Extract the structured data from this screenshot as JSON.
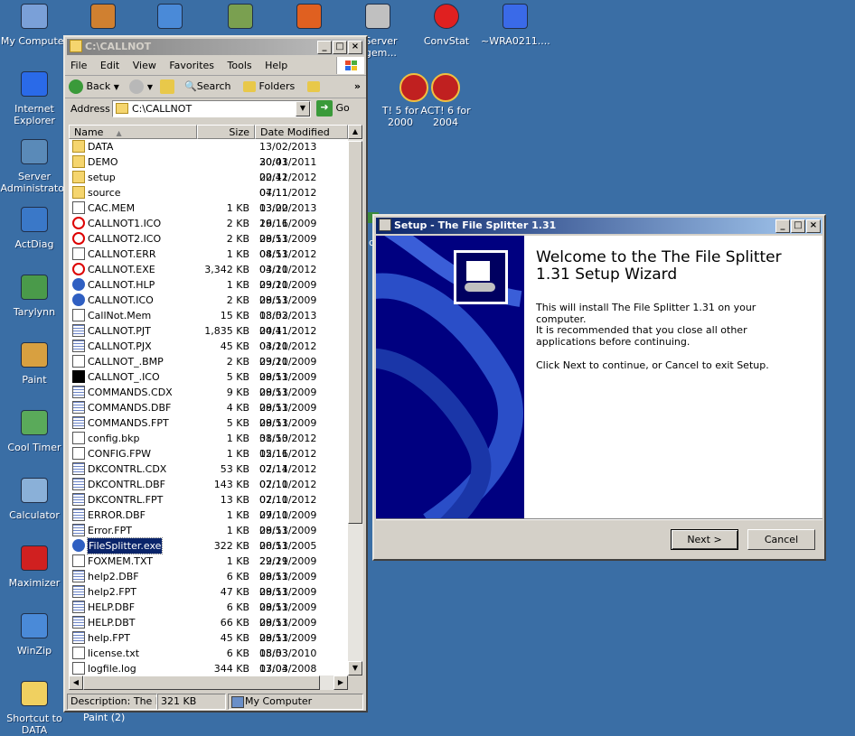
{
  "desktop": {
    "icons_left": [
      {
        "label": "My Computer",
        "icon": "computer-icon"
      },
      {
        "label": "Internet Explorer",
        "icon": "ie-icon"
      },
      {
        "label": "Server Administrator",
        "icon": "server-admin-icon"
      },
      {
        "label": "ActDiag",
        "icon": "toolbox-icon"
      },
      {
        "label": "Tarylynn",
        "icon": "network-icon"
      },
      {
        "label": "Paint",
        "icon": "paint-icon"
      },
      {
        "label": "Cool Timer",
        "icon": "timer-icon"
      },
      {
        "label": "Calculator",
        "icon": "calculator-icon"
      },
      {
        "label": "Maximizer",
        "icon": "maximizer-icon"
      },
      {
        "label": "WinZip",
        "icon": "winzip-icon"
      },
      {
        "label": "Shortcut to DATA",
        "icon": "folder-shortcut-icon"
      }
    ],
    "icons_top": [
      {
        "label": "",
        "icon": "handshake-icon"
      },
      {
        "label": "",
        "icon": "sync-icon"
      },
      {
        "label": "",
        "icon": "handshake-icon"
      },
      {
        "label": "",
        "icon": "fox-icon"
      },
      {
        "label": ". Server agem...",
        "icon": "server-manager-icon"
      },
      {
        "label": "ConvStat",
        "icon": "target-icon"
      },
      {
        "label": "~WRA0211....",
        "icon": "word-doc-icon"
      }
    ],
    "icons_mid": [
      {
        "label": "T! 5 for 2000",
        "icon": "act-icon"
      },
      {
        "label": "ACT! 6 for 2004",
        "icon": "act-icon"
      }
    ],
    "paint2_label": "Paint (2)",
    "stray_label": "d"
  },
  "explorer": {
    "title": "C:\\CALLNOT",
    "menu": [
      "File",
      "Edit",
      "View",
      "Favorites",
      "Tools",
      "Help"
    ],
    "toolbar": {
      "back": "Back",
      "search": "Search",
      "folders": "Folders"
    },
    "address_label": "Address",
    "address_value": "C:\\CALLNOT",
    "go_label": "Go",
    "columns": {
      "name": "Name",
      "size": "Size",
      "date": "Date Modified"
    },
    "files": [
      {
        "name": "DATA",
        "size": "",
        "date": "13/02/2013 20:41",
        "type": "folder"
      },
      {
        "name": "DEMO",
        "size": "",
        "date": "30/03/2011 20:42",
        "type": "folder"
      },
      {
        "name": "setup",
        "size": "",
        "date": "02/11/2012 07:11",
        "type": "folder"
      },
      {
        "name": "source",
        "size": "",
        "date": "04/11/2012 03:20",
        "type": "folder"
      },
      {
        "name": "CAC.MEM",
        "size": "1 KB",
        "date": "13/02/2013 16:16",
        "type": "doc"
      },
      {
        "name": "CALLNOT1.ICO",
        "size": "2 KB",
        "date": "29/11/2009 08:53",
        "type": "red"
      },
      {
        "name": "CALLNOT2.ICO",
        "size": "2 KB",
        "date": "29/11/2009 08:53",
        "type": "red"
      },
      {
        "name": "CALLNOT.ERR",
        "size": "1 KB",
        "date": "04/11/2012 03:20",
        "type": "doc"
      },
      {
        "name": "CALLNOT.EXE",
        "size": "3,342 KB",
        "date": "04/11/2012 03:20",
        "type": "red"
      },
      {
        "name": "CALLNOT.HLP",
        "size": "1 KB",
        "date": "29/11/2009 08:53",
        "type": "blue"
      },
      {
        "name": "CALLNOT.ICO",
        "size": "2 KB",
        "date": "29/11/2009 08:53",
        "type": "blue"
      },
      {
        "name": "CallNot.Mem",
        "size": "15 KB",
        "date": "13/02/2013 20:41",
        "type": "doc"
      },
      {
        "name": "CALLNOT.PJT",
        "size": "1,835 KB",
        "date": "04/11/2012 03:20",
        "type": "grid"
      },
      {
        "name": "CALLNOT.PJX",
        "size": "45 KB",
        "date": "04/11/2012 03:20",
        "type": "grid"
      },
      {
        "name": "CALLNOT_.BMP",
        "size": "2 KB",
        "date": "29/11/2009 08:53",
        "type": "doc"
      },
      {
        "name": "CALLNOT_.ICO",
        "size": "5 KB",
        "date": "29/11/2009 08:53",
        "type": "black"
      },
      {
        "name": "COMMANDS.CDX",
        "size": "9 KB",
        "date": "29/11/2009 08:53",
        "type": "grid"
      },
      {
        "name": "COMMANDS.DBF",
        "size": "4 KB",
        "date": "29/11/2009 08:53",
        "type": "grid"
      },
      {
        "name": "COMMANDS.FPT",
        "size": "5 KB",
        "date": "29/11/2009 08:53",
        "type": "grid"
      },
      {
        "name": "config.bkp",
        "size": "1 KB",
        "date": "31/10/2012 15:16",
        "type": "doc"
      },
      {
        "name": "CONFIG.FPW",
        "size": "1 KB",
        "date": "02/11/2012 07:14",
        "type": "doc"
      },
      {
        "name": "DKCONTRL.CDX",
        "size": "53 KB",
        "date": "02/11/2012 07:10",
        "type": "grid"
      },
      {
        "name": "DKCONTRL.DBF",
        "size": "143 KB",
        "date": "02/11/2012 07:10",
        "type": "grid"
      },
      {
        "name": "DKCONTRL.FPT",
        "size": "13 KB",
        "date": "02/11/2012 07:10",
        "type": "grid"
      },
      {
        "name": "ERROR.DBF",
        "size": "1 KB",
        "date": "29/11/2009 08:53",
        "type": "grid"
      },
      {
        "name": "Error.FPT",
        "size": "1 KB",
        "date": "29/11/2009 08:53",
        "type": "grid"
      },
      {
        "name": "FileSplitter.exe",
        "size": "322 KB",
        "date": "20/11/2005 22:29",
        "type": "exe",
        "selected": true
      },
      {
        "name": "FOXMEM.TXT",
        "size": "1 KB",
        "date": "29/11/2009 08:53",
        "type": "doc"
      },
      {
        "name": "help2.DBF",
        "size": "6 KB",
        "date": "29/11/2009 08:53",
        "type": "grid"
      },
      {
        "name": "help2.FPT",
        "size": "47 KB",
        "date": "29/11/2009 08:53",
        "type": "grid"
      },
      {
        "name": "HELP.DBF",
        "size": "6 KB",
        "date": "29/11/2009 08:53",
        "type": "grid"
      },
      {
        "name": "HELP.DBT",
        "size": "66 KB",
        "date": "29/11/2009 08:53",
        "type": "grid"
      },
      {
        "name": "help.FPT",
        "size": "45 KB",
        "date": "29/11/2009 08:53",
        "type": "grid"
      },
      {
        "name": "license.txt",
        "size": "6 KB",
        "date": "15/03/2010 03:03",
        "type": "doc"
      },
      {
        "name": "logfile.log",
        "size": "344 KB",
        "date": "17/04/2008 03:18",
        "type": "doc"
      }
    ],
    "status": {
      "description": "Description: The File",
      "size": "321 KB",
      "location": "My Computer"
    }
  },
  "setup": {
    "title": "Setup - The File Splitter 1.31",
    "heading": "Welcome to the The File Splitter 1.31 Setup Wizard",
    "para1": "This will install The File Splitter 1.31 on your computer.",
    "para2": "It is recommended that you close all other applications before continuing.",
    "para3": "Click Next to continue, or Cancel to exit Setup.",
    "next_label": "Next >",
    "cancel_label": "Cancel"
  },
  "colors": {
    "desktop": "#3a6ea5",
    "titlebar_active": "#0a246a",
    "titlebar_inactive": "#808080",
    "wizard_panel": "#000080"
  }
}
